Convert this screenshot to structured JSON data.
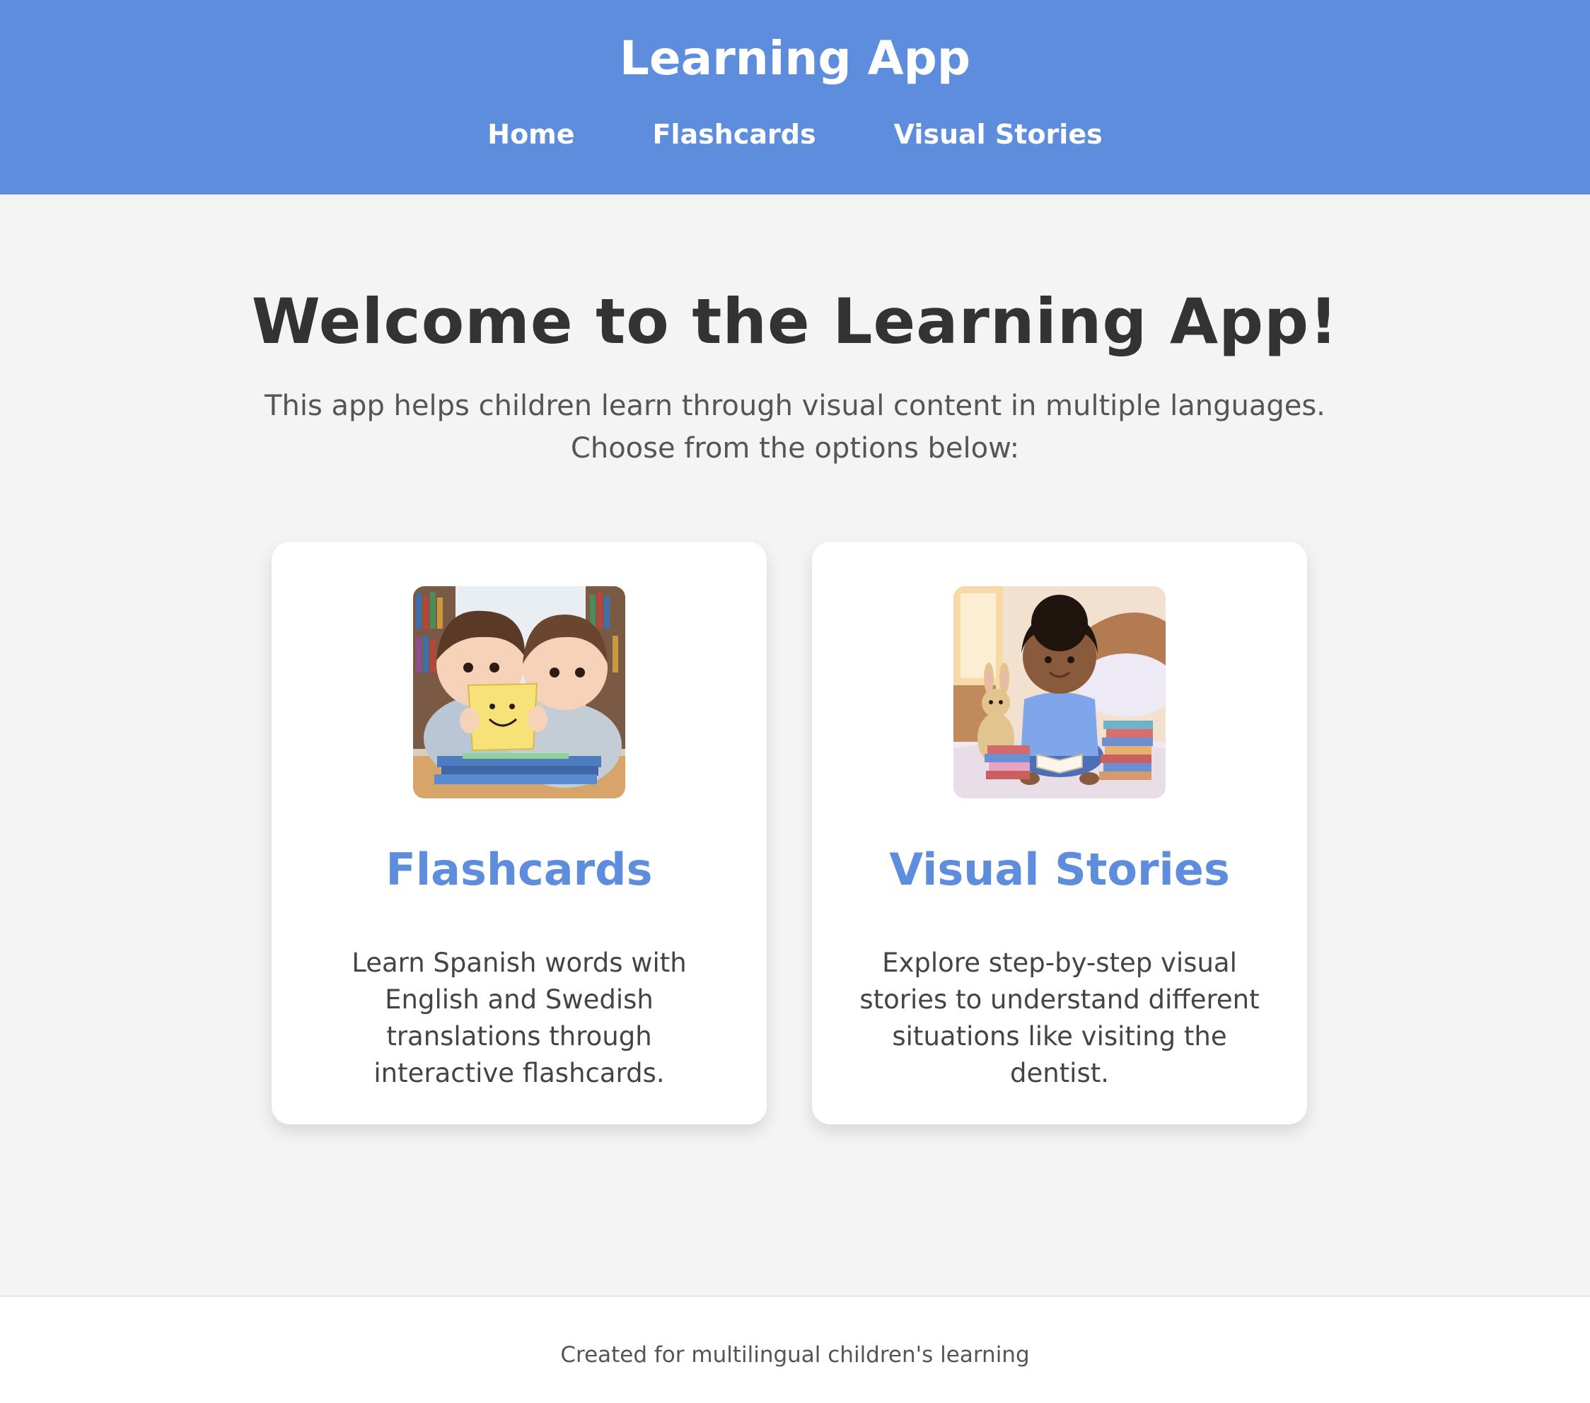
{
  "header": {
    "title": "Learning App",
    "nav": [
      "Home",
      "Flashcards",
      "Visual Stories"
    ],
    "background_color": "#5d8ddc"
  },
  "main": {
    "heading": "Welcome to the Learning App!",
    "intro": "This app helps children learn through visual content in multiple languages. Choose from the options below:",
    "cards": [
      {
        "title": "Flashcards",
        "description": "Learn Spanish words with English and Swedish translations through interactive flashcards.",
        "image": "two-children-with-flashcard-illustration"
      },
      {
        "title": "Visual Stories",
        "description": "Explore step-by-step visual stories to understand different situations like visiting the dentist.",
        "image": "child-reading-on-bed-illustration"
      }
    ],
    "accent_color": "#5d8ddc"
  },
  "footer": {
    "text": "Created for multilingual children's learning"
  }
}
